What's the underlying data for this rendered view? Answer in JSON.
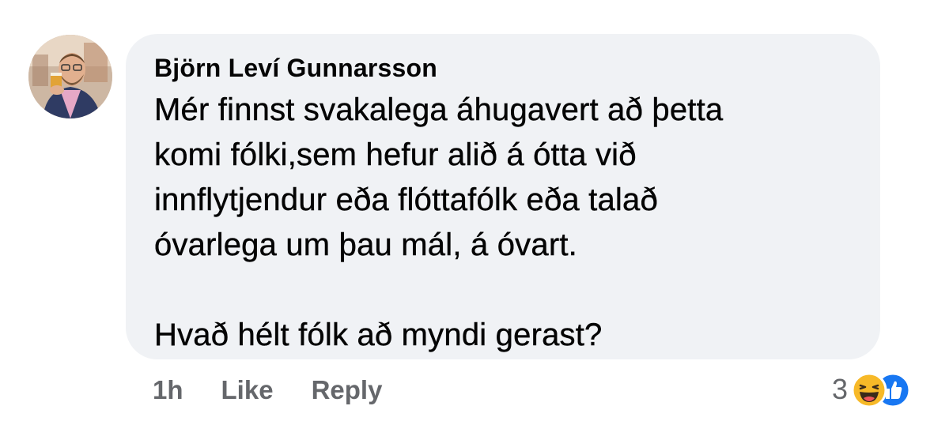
{
  "comment": {
    "author": "Björn Leví Gunnarsson",
    "text": "Mér finnst svakalega áhugavert að þetta\nkomi fólki,sem hefur alið á ótta við\ninnflytjendur eða flóttafólk eða talað\nóvarlega um þau mál, á óvart.\n\nHvað hélt fólk að myndi gerast?",
    "avatar_icon": "profile-photo"
  },
  "actions": {
    "timestamp": "1h",
    "like_label": "Like",
    "reply_label": "Reply"
  },
  "reactions": {
    "count": "3",
    "icons": [
      "haha-reaction-icon",
      "like-reaction-icon"
    ]
  },
  "colors": {
    "bubble_bg": "#f0f2f5",
    "text": "#050505",
    "secondary_text": "#65676b",
    "like_blue": "#1877f2",
    "haha_yellow": "#f7b928"
  }
}
